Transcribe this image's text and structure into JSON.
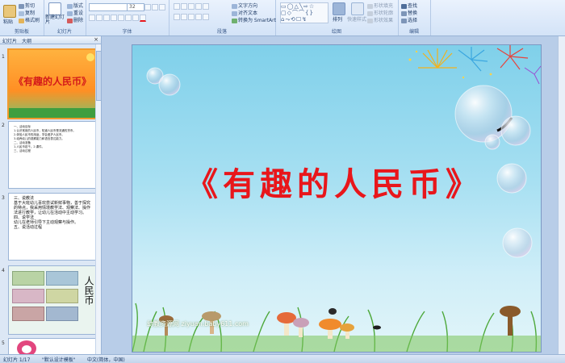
{
  "ribbon": {
    "clipboard": {
      "paste": "粘贴",
      "cut": "剪切",
      "copy": "复制",
      "format_painter": "格式刷",
      "label": "剪贴板"
    },
    "slides": {
      "new_slide": "新建幻灯片",
      "layout": "版式",
      "reset": "重设",
      "delete": "删除",
      "label": "幻灯片"
    },
    "font": {
      "size": "32",
      "label": "字体"
    },
    "paragraph": {
      "text_direction": "文字方向",
      "align_text": "对齐文本",
      "convert_smartart": "转换为 SmartArt",
      "label": "段落"
    },
    "drawing": {
      "arrange": "排列",
      "quick_styles": "快速样式",
      "shape_fill": "形状填充",
      "shape_outline": "形状轮廓",
      "shape_effects": "形状效果",
      "label": "绘图"
    },
    "editing": {
      "find": "查找",
      "replace": "替换",
      "select": "选择",
      "label": "编辑"
    }
  },
  "panel": {
    "tab_slides": "幻灯片",
    "tab_outline": "大纲",
    "close": "×",
    "slide_numbers": [
      "1",
      "2",
      "3",
      "4",
      "5"
    ],
    "slide1_title": "《有趣的人民币》",
    "slide2_lines": [
      "一、活动目标",
      "1.认识常用的人民币，知道人民币是流通的货币。",
      "2.体验人民币的用途，学会爱护人民币。",
      "3.培养幼儿的观察能力和语言表达能力。",
      "二、活动准备",
      "1.人民币若干。2.课件。",
      "三、活动过程"
    ],
    "slide3_lines": [
      "三、说教法",
      "基于大班幼儿喜欢尝试新鲜事物，善于探究的特点，我采用情境教学法、观察法、操作法进行教学，让幼儿在活动中主动学习。",
      "四、说学法",
      "幼儿在老师引导下主动观察与操作。",
      "五、说活动过程"
    ],
    "slide4_title": "人民币"
  },
  "slide": {
    "title": "《有趣的人民币》",
    "watermark": "幼教资源网 ziyuan.baby611.com"
  },
  "status": {
    "slide_of": "幻灯片 1/17",
    "theme": "\"默认设计模板\"",
    "language": "中文(简体，中国)"
  },
  "colors": {
    "title_red": "#e8161b",
    "selection_orange": "#f29a2e",
    "ribbon_blue": "#d3e3f7"
  }
}
